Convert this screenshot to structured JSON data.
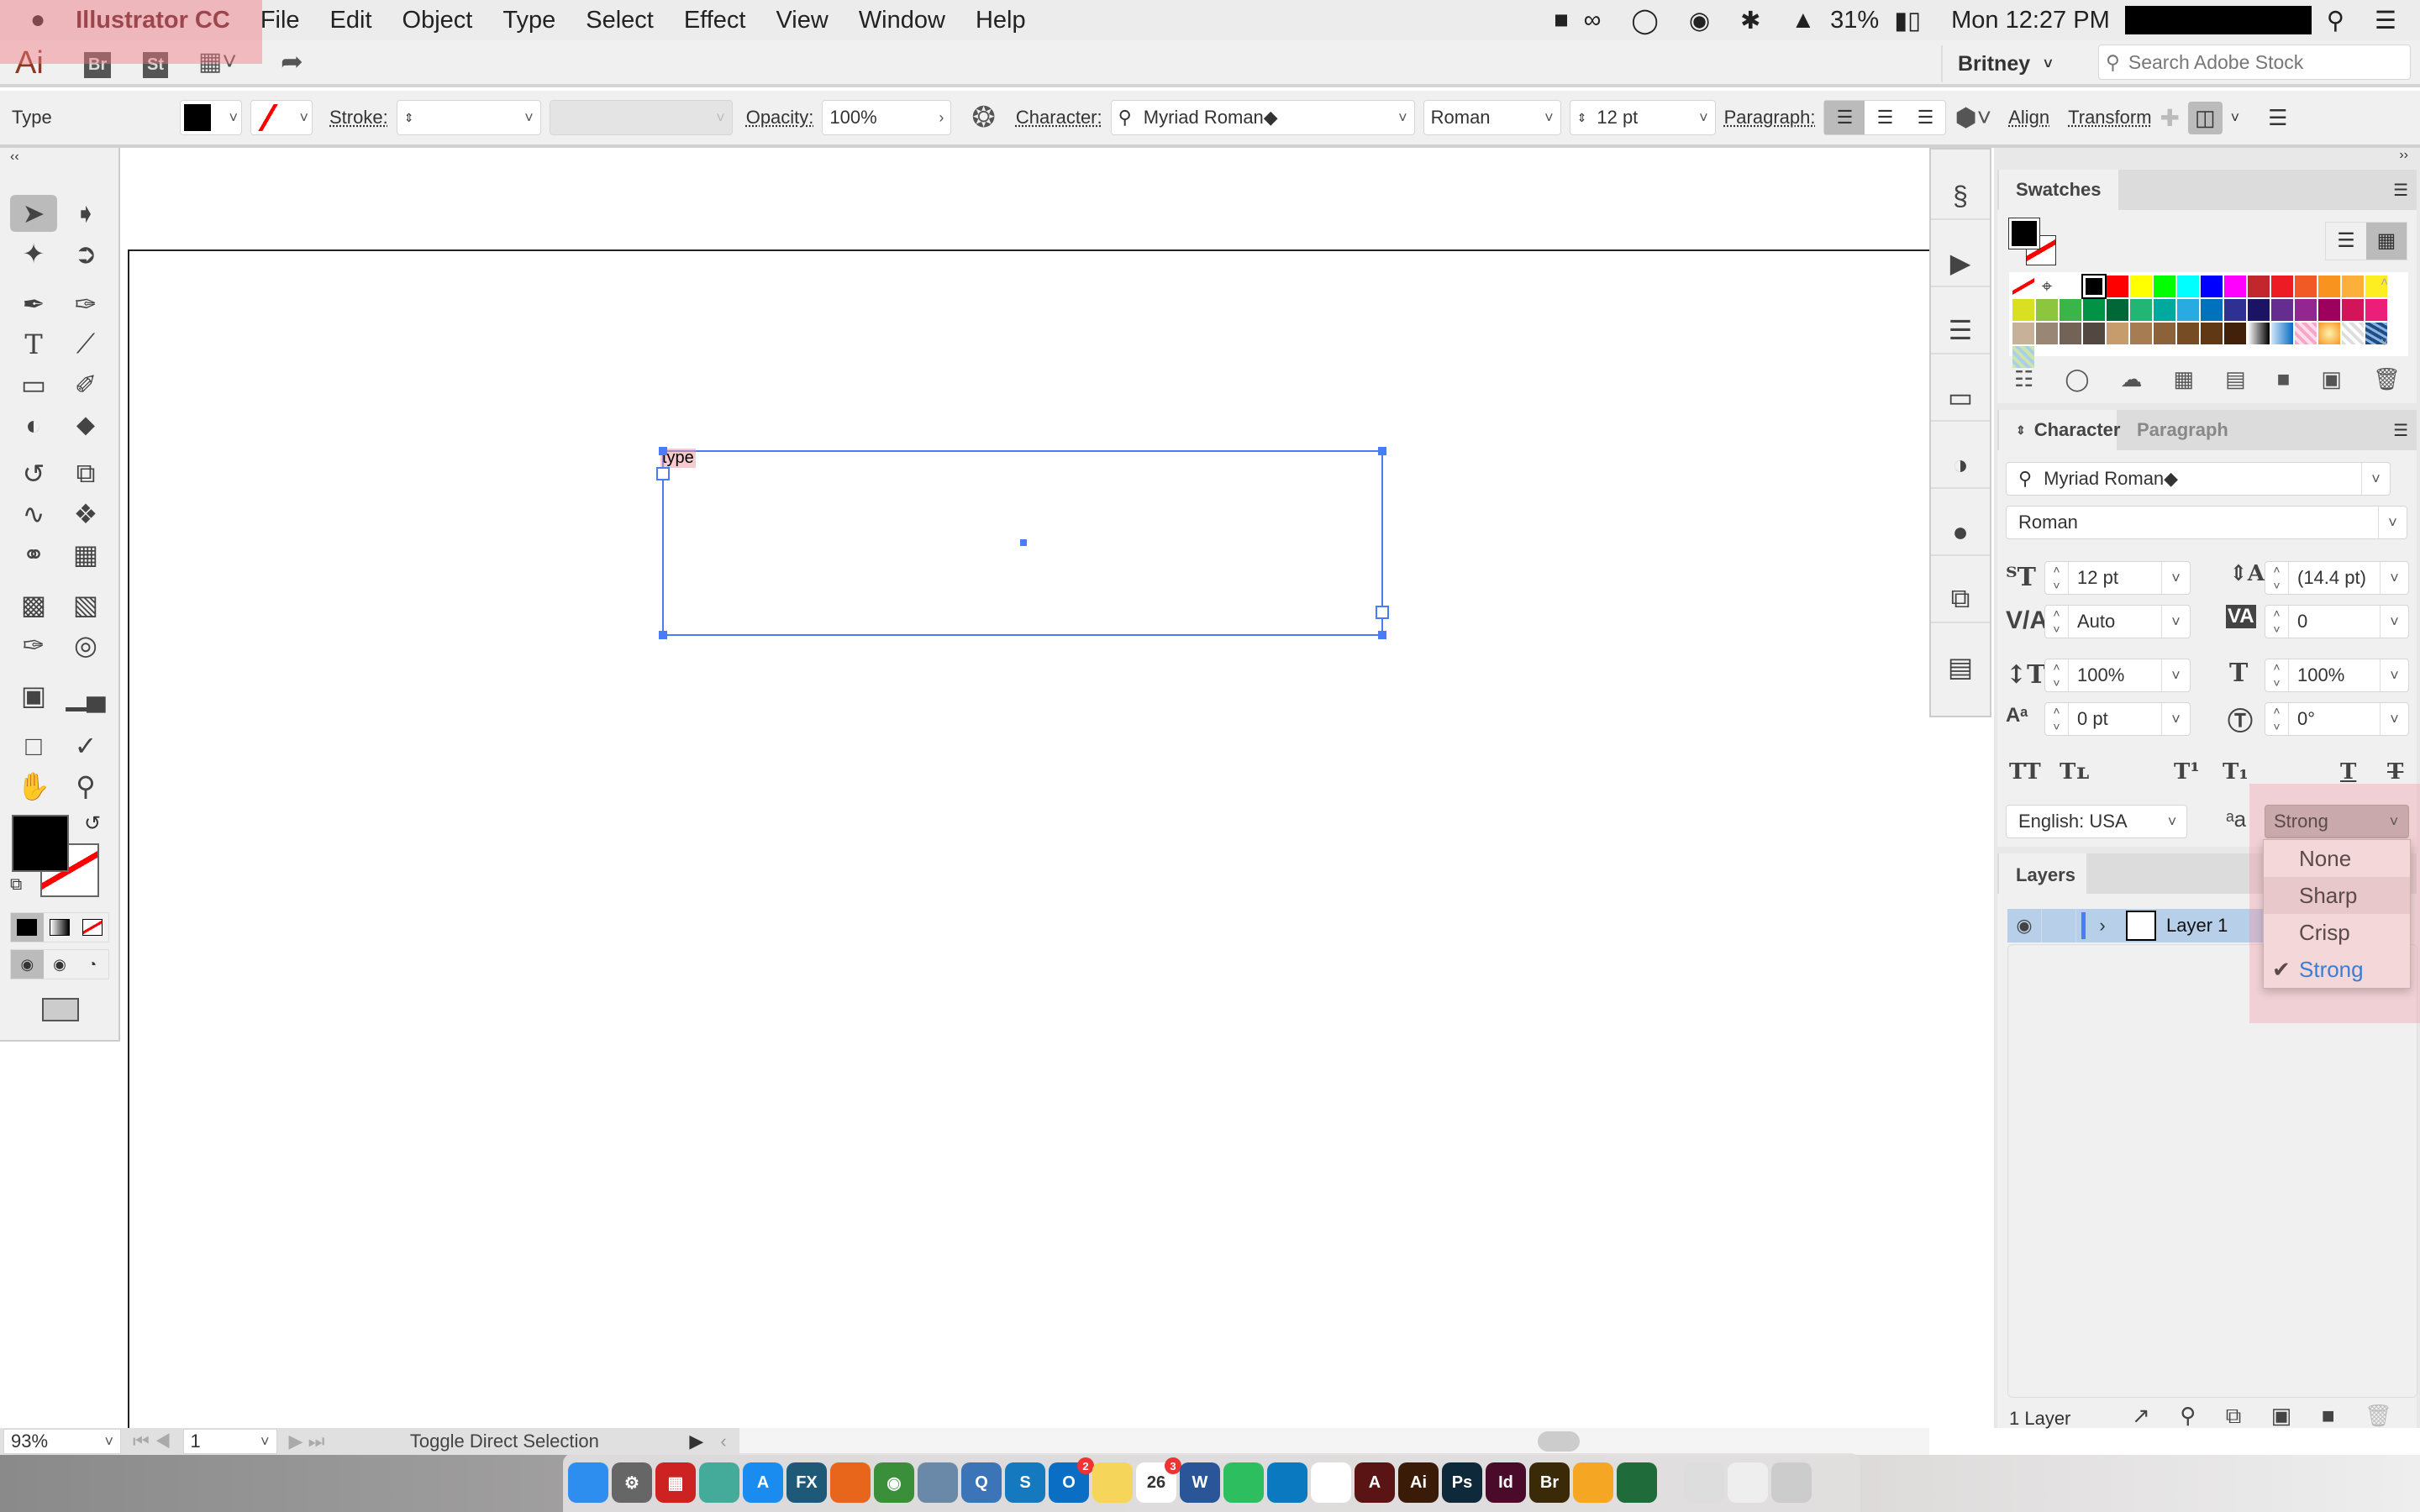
{
  "menubar": {
    "app": "Illustrator CC",
    "items": [
      "File",
      "Edit",
      "Object",
      "Type",
      "Select",
      "Effect",
      "View",
      "Window",
      "Help"
    ],
    "battery": "31%",
    "clock": "Mon 12:27 PM"
  },
  "appbar": {
    "logo": "Ai",
    "bridge": "Br",
    "stock": "St",
    "workspace": "Britney",
    "search_placeholder": "Search Adobe Stock"
  },
  "control": {
    "selection_label": "Type",
    "stroke_label": "Stroke:",
    "opacity_label": "Opacity:",
    "opacity": "100%",
    "character_label": "Character:",
    "font": "Myriad Roman◆",
    "style": "Roman",
    "size": "12 pt",
    "paragraph_label": "Paragraph:",
    "align_label": "Align",
    "transform_label": "Transform"
  },
  "canvas": {
    "text": "type"
  },
  "swatches": {
    "tab": "Swatches",
    "colors": [
      [
        "none",
        "registration",
        "#ffffff",
        "#000000",
        "#ff0000",
        "#ffff00",
        "#00ff00",
        "#00ffff",
        "#0000ff",
        "#ff00ff",
        "#c1272d",
        "#ed1c24",
        "#f15a24",
        "#f7931e",
        "#fbb03b",
        "#fcee21"
      ],
      [
        "#d9e021",
        "#8cc63f",
        "#39b54a",
        "#009245",
        "#006837",
        "#22b573",
        "#00a99d",
        "#29abe2",
        "#0071bc",
        "#2e3192",
        "#1b1464",
        "#662d91",
        "#93278f",
        "#9e005d",
        "#d4145a",
        "#ed1e79"
      ],
      [
        "#c7b299",
        "#998675",
        "#736357",
        "#534741",
        "#c69c6d",
        "#a67c52",
        "#8c6239",
        "#754c24",
        "#603813",
        "#42210b",
        "linear-gradient(90deg,#fff,#000)",
        "linear-gradient(90deg,#cfe6f8,#0a6cc4)",
        "repeating-linear-gradient(45deg,#f7a7c4 0 4px,#fde 4px 8px)",
        "radial-gradient(#fff3b0,#f7931e)",
        "repeating-linear-gradient(45deg,#ddd 0 4px,#fff 4px 8px)",
        "repeating-linear-gradient(30deg,#1d4e8a 0 4px,#8fb4de 4px 7px)"
      ],
      [
        "repeating-linear-gradient(45deg,#cfe4a8 0 4px,#a9d0e8 4px 8px)"
      ]
    ]
  },
  "character": {
    "tab": "Character",
    "tab2": "Paragraph",
    "font": "Myriad Roman◆",
    "style": "Roman",
    "size": "12 pt",
    "leading": "(14.4 pt)",
    "kerning": "Auto",
    "tracking": "0",
    "vscale": "100%",
    "hscale": "100%",
    "baseline": "0 pt",
    "rotation": "0°",
    "language": "English: USA",
    "antialias": "Strong"
  },
  "antialias_menu": {
    "options": [
      "None",
      "Sharp",
      "Crisp",
      "Strong"
    ],
    "selected": "Strong",
    "hovered": "Sharp"
  },
  "layers": {
    "tab": "Layers",
    "rows": [
      {
        "name": "Layer 1"
      }
    ],
    "count": "1 Layer"
  },
  "status": {
    "zoom": "93%",
    "artboard": "1",
    "message": "Toggle Direct Selection"
  },
  "dock": {
    "apps": [
      {
        "name": "finder",
        "c": "#2d8ef0",
        "t": ""
      },
      {
        "name": "system-preferences",
        "c": "#666",
        "t": "⚙"
      },
      {
        "name": "fortinet",
        "c": "#c22",
        "t": "▦"
      },
      {
        "name": "forticlient-vpn",
        "c": "#4a9",
        "t": ""
      },
      {
        "name": "app-store",
        "c": "#1a8cf0",
        "t": "A"
      },
      {
        "name": "fx",
        "c": "#1e5a78",
        "t": "FX"
      },
      {
        "name": "firefox",
        "c": "#e8661b",
        "t": ""
      },
      {
        "name": "chrome",
        "c": "#3a8f3a",
        "t": "◉"
      },
      {
        "name": "preview",
        "c": "#6a88a8",
        "t": ""
      },
      {
        "name": "quicktime",
        "c": "#3c74b8",
        "t": "Q"
      },
      {
        "name": "skype",
        "c": "#1479be",
        "t": "S"
      },
      {
        "name": "outlook",
        "c": "#0a6ec4",
        "t": "O",
        "badge": "2"
      },
      {
        "name": "notes",
        "c": "#f5d65a",
        "t": ""
      },
      {
        "name": "calendar",
        "c": "#fff",
        "t": "26",
        "badge": "3"
      },
      {
        "name": "word",
        "c": "#2a5699",
        "t": "W"
      },
      {
        "name": "evernote",
        "c": "#2dbe60",
        "t": ""
      },
      {
        "name": "trello",
        "c": "#0b79bf",
        "t": ""
      },
      {
        "name": "reminders",
        "c": "#fff",
        "t": ""
      },
      {
        "name": "acrobat",
        "c": "#5a1414",
        "t": "A"
      },
      {
        "name": "illustrator",
        "c": "#3a1b08",
        "t": "Ai"
      },
      {
        "name": "photoshop",
        "c": "#0e2a3a",
        "t": "Ps"
      },
      {
        "name": "indesign",
        "c": "#4a0a2a",
        "t": "Id"
      },
      {
        "name": "bridge",
        "c": "#3a2a08",
        "t": "Br"
      },
      {
        "name": "sketch",
        "c": "#f5a623",
        "t": ""
      },
      {
        "name": "sourcetree",
        "c": "#1f6b3a",
        "t": ""
      },
      {
        "name": "screenshot-window",
        "c": "#ddd",
        "t": ""
      },
      {
        "name": "skype-doc",
        "c": "#eee",
        "t": ""
      },
      {
        "name": "trash",
        "c": "#ccc",
        "t": ""
      }
    ]
  }
}
